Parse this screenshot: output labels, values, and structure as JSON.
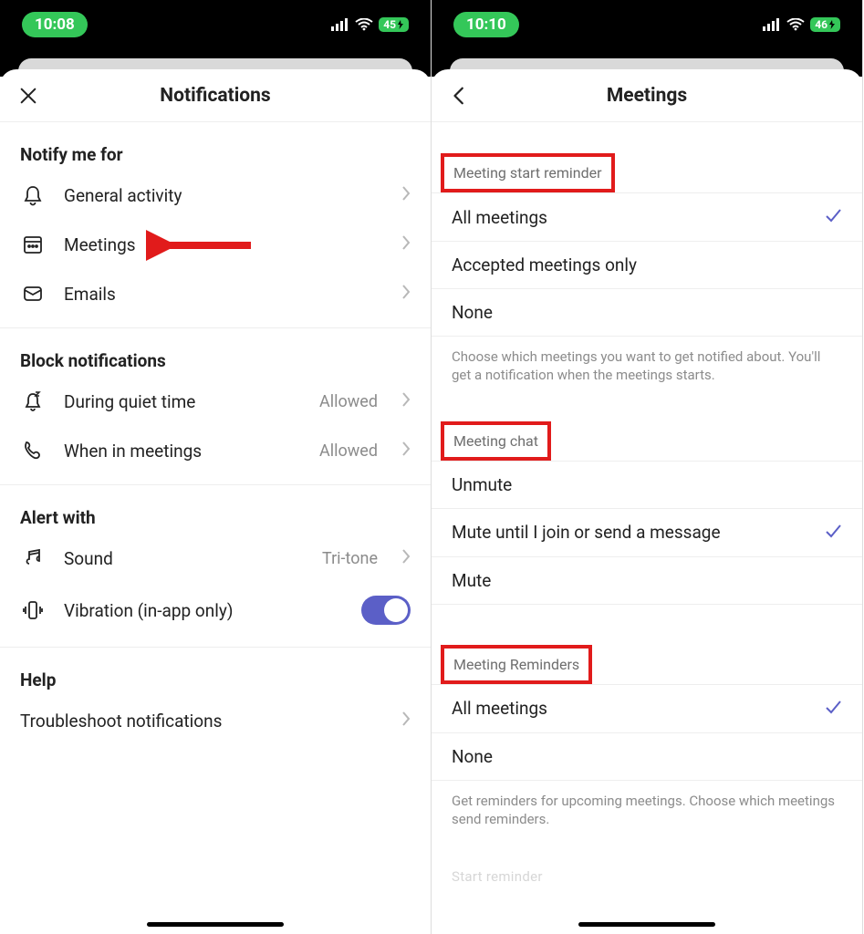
{
  "left": {
    "time": "10:08",
    "battery": "45",
    "title": "Notifications",
    "sections": {
      "notify": {
        "header": "Notify me for",
        "items": {
          "general": "General activity",
          "meetings": "Meetings",
          "emails": "Emails"
        }
      },
      "block": {
        "header": "Block notifications",
        "items": {
          "quiet": {
            "label": "During quiet time",
            "value": "Allowed"
          },
          "inmeetings": {
            "label": "When in meetings",
            "value": "Allowed"
          }
        }
      },
      "alert": {
        "header": "Alert with",
        "items": {
          "sound": {
            "label": "Sound",
            "value": "Tri-tone"
          },
          "vibration": {
            "label": "Vibration (in-app only)"
          }
        }
      },
      "help": {
        "header": "Help",
        "items": {
          "troubleshoot": "Troubleshoot notifications"
        }
      }
    }
  },
  "right": {
    "time": "10:10",
    "battery": "46",
    "title": "Meetings",
    "groups": {
      "start": {
        "header": "Meeting start reminder",
        "options": {
          "all": "All meetings",
          "accepted": "Accepted meetings only",
          "none": "None"
        },
        "selected": "all",
        "footer": "Choose which meetings you want to get notified about. You'll get a notification when the meetings starts."
      },
      "chat": {
        "header": "Meeting chat",
        "options": {
          "unmute": "Unmute",
          "mutejoin": "Mute until I join or send a message",
          "mute": "Mute"
        },
        "selected": "mutejoin"
      },
      "reminders": {
        "header": "Meeting Reminders",
        "options": {
          "all": "All meetings",
          "none": "None"
        },
        "selected": "all",
        "footer": "Get reminders for upcoming meetings. Choose which meetings send reminders."
      }
    },
    "cutoff": "Start reminder"
  }
}
